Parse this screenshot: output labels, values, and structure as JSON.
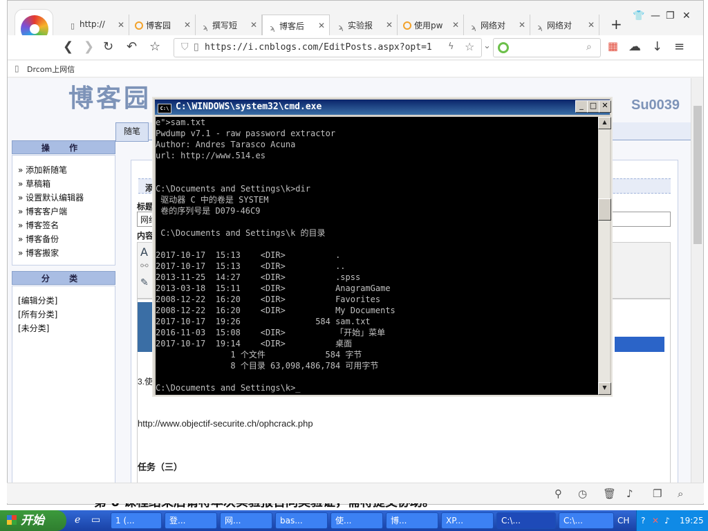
{
  "browser": {
    "tabs": [
      {
        "label": "http://",
        "icon": "page-icon"
      },
      {
        "label": "博客园",
        "icon": "circle-icon"
      },
      {
        "label": "撰写短",
        "icon": "paw-icon"
      },
      {
        "label": "博客后",
        "icon": "paw-icon"
      },
      {
        "label": "实验报",
        "icon": "paw-icon"
      },
      {
        "label": "使用pw",
        "icon": "circle-icon"
      },
      {
        "label": "网络对",
        "icon": "paw-icon"
      },
      {
        "label": "网络对",
        "icon": "paw-icon"
      }
    ],
    "new_tab": "+",
    "url": "https://i.cnblogs.com/EditPosts.aspx?opt=1",
    "bookmark": "Drcom上网信"
  },
  "page": {
    "blog_title": "博客园",
    "user": "Su0039",
    "tab_label": "随笔",
    "ops_header": "操 作",
    "ops_items": [
      "» 添加新随笔",
      "» 草稿箱",
      "» 设置默认编辑器",
      "» 博客客户端",
      "» 博客签名",
      "» 博客备份",
      "» 博客搬家"
    ],
    "cat_header": "分 类",
    "cat_items": [
      "[编辑分类]",
      "[所有分类]",
      "[未分类]"
    ],
    "add_label": "添",
    "title_label": "标题",
    "title_value": "网络",
    "content_label": "内容",
    "step_text": "3.使",
    "link_text": "http://www.objectif-securite.ch/ophcrack.php",
    "task_heading": "任务（三）",
    "bottom_text": "第 6 课程结束后请将本次实验报告同类验证，需将提交协助。"
  },
  "cmd": {
    "title": "C:\\WINDOWS\\system32\\cmd.exe",
    "lines": [
      "e\">sam.txt",
      "Pwdump v7.1 - raw password extractor",
      "Author: Andres Tarasco Acuna",
      "url: http://www.514.es",
      "",
      "",
      "C:\\Documents and Settings\\k>dir",
      " 驱动器 C 中的卷是 SYSTEM",
      " 卷的序列号是 D079-46C9",
      "",
      " C:\\Documents and Settings\\k 的目录",
      "",
      "2017-10-17  15:13    <DIR>          .",
      "2017-10-17  15:13    <DIR>          ..",
      "2013-11-25  14:27    <DIR>          .spss",
      "2013-03-18  15:11    <DIR>          AnagramGame",
      "2008-12-22  16:20    <DIR>          Favorites",
      "2008-12-22  16:20    <DIR>          My Documents",
      "2017-10-17  19:26               584 sam.txt",
      "2016-11-03  15:08    <DIR>          「开始」菜单",
      "2017-10-17  19:14    <DIR>          桌面",
      "               1 个文件            584 字节",
      "               8 个目录 63,098,486,784 可用字节",
      "",
      "C:\\Documents and Settings\\k>_"
    ]
  },
  "taskbar": {
    "start": "开始",
    "tasks": [
      "1 (...",
      "登...",
      "网...",
      "bas...",
      "使...",
      "博...",
      "XP...",
      "C:\\...",
      "C:\\..."
    ],
    "lang": "CH",
    "clock": "19:25"
  }
}
